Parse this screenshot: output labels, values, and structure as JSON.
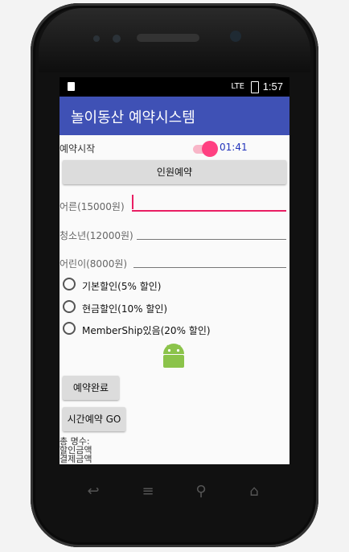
{
  "status_bar": {
    "time": "1:57",
    "signal": "LTE"
  },
  "app": {
    "title": "놀이동산 예약시스템"
  },
  "reservation": {
    "start_label": "예약시작",
    "switch_on": true,
    "timer": "01:41"
  },
  "buttons": {
    "group_booking": "인원예약",
    "complete": "예약완료",
    "time_booking": "시간예약 GO"
  },
  "fields": [
    {
      "label": "어른(15000원)",
      "value": "",
      "focused": true
    },
    {
      "label": "청소년(12000원)",
      "value": "",
      "focused": false
    },
    {
      "label": "어린이(8000원)",
      "value": "",
      "focused": false
    }
  ],
  "discounts": [
    {
      "label": "기본할인(5% 할인)",
      "checked": false
    },
    {
      "label": "현금할인(10% 할인)",
      "checked": false
    },
    {
      "label": "MemberShip있음(20% 할인)",
      "checked": false
    }
  ],
  "summary": {
    "line1": "총 명수:",
    "line2": "할인금액",
    "line3": "결제금액"
  },
  "colors": {
    "primary": "#3f51b5",
    "accent": "#ff4081",
    "timer": "#2233bb"
  }
}
